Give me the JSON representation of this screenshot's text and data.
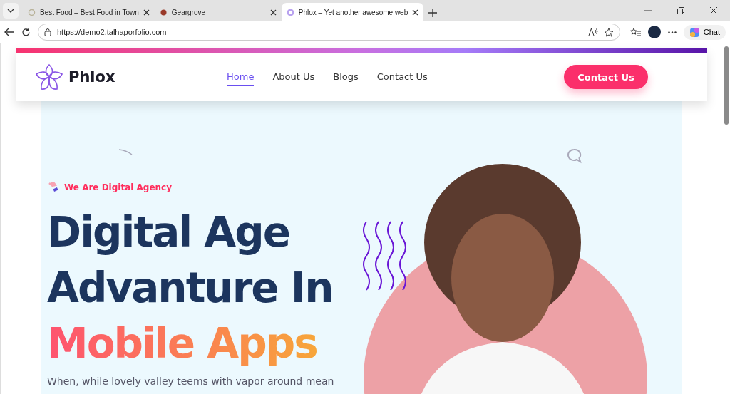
{
  "browser": {
    "tabs": [
      {
        "title": "Best Food – Best Food in Town",
        "selected": false
      },
      {
        "title": "Geargrove",
        "selected": false
      },
      {
        "title": "Phlox – Yet another awesome web",
        "selected": true
      }
    ],
    "url": "https://demo2.talhaporfolio.com",
    "chat_label": "Chat"
  },
  "site": {
    "logo": "Phlox",
    "nav": [
      {
        "label": "Home",
        "selected": true
      },
      {
        "label": "About Us",
        "selected": false
      },
      {
        "label": "Blogs",
        "selected": false
      },
      {
        "label": "Contact Us",
        "selected": false
      }
    ],
    "cta": "Contact Us"
  },
  "hero": {
    "eyebrow": "We Are Digital Agency",
    "headline_lines": [
      "Digital Age",
      "Advanture In"
    ],
    "highlight": "Mobile Apps",
    "paragraph": "When, while lovely valley teems with vapor around mean"
  }
}
